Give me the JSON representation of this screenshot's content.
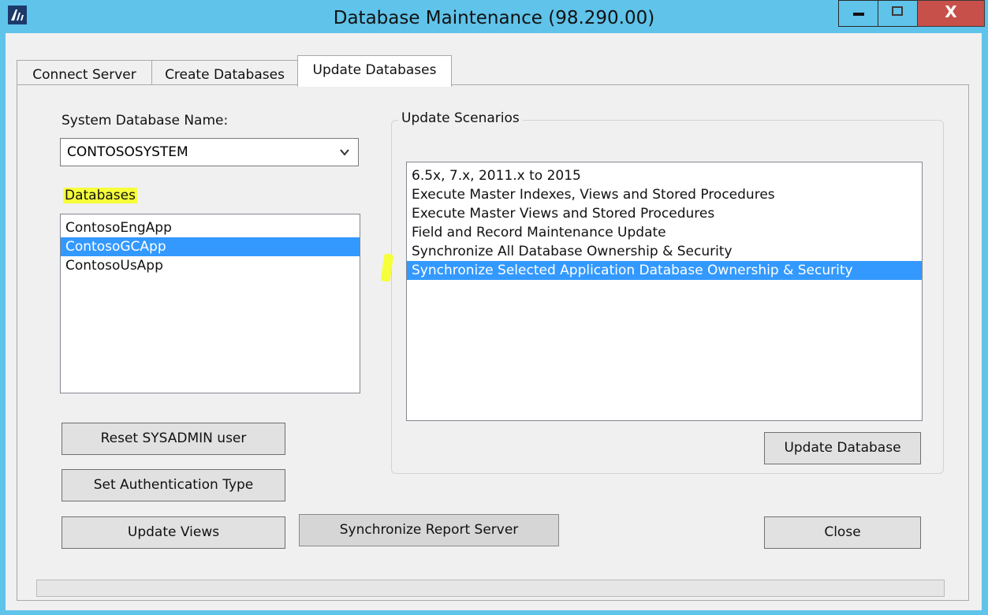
{
  "window": {
    "title": "Database Maintenance (98.290.00)",
    "close_glyph": "X"
  },
  "tabs": [
    {
      "label": "Connect Server"
    },
    {
      "label": "Create Databases"
    },
    {
      "label": "Update Databases"
    }
  ],
  "system_db": {
    "label": "System Database Name:",
    "value": "CONTOSOSYSTEM"
  },
  "databases": {
    "label": "Databases",
    "items": [
      "ContosoEngApp",
      "ContosoGCApp",
      "ContosoUsApp"
    ],
    "selected": "ContosoGCApp"
  },
  "update_scenarios": {
    "label": "Update Scenarios",
    "items": [
      "6.5x, 7.x, 2011.x to 2015",
      "Execute Master Indexes, Views and Stored Procedures",
      "Execute Master Views and Stored Procedures",
      "Field and Record Maintenance Update",
      "Synchronize All Database Ownership & Security",
      "Synchronize Selected Application Database Ownership & Security"
    ],
    "selected": "Synchronize Selected Application Database Ownership & Security"
  },
  "buttons": {
    "reset_sysadmin": "Reset SYSADMIN user",
    "set_auth": "Set Authentication Type",
    "update_views": "Update Views",
    "sync_report": "Synchronize Report Server",
    "update_database": "Update Database",
    "close": "Close"
  },
  "progress": {
    "value": 0
  },
  "colors": {
    "titlebar": "#5fc3ea",
    "selection": "#3399ff",
    "highlight": "#f6ff3a",
    "close_button": "#c7504a"
  },
  "icons": {
    "app": "app-logo-icon",
    "minimize": "minimize-icon",
    "maximize": "maximize-icon",
    "close": "close-icon",
    "dropdown": "chevron-down-icon"
  }
}
